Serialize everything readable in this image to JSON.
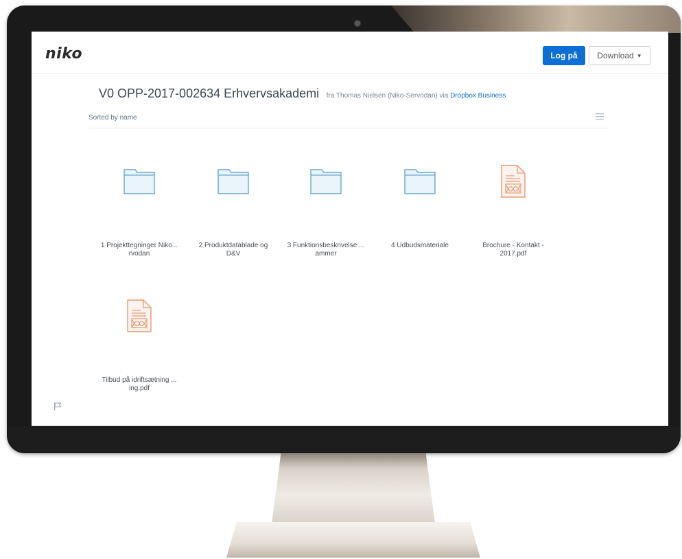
{
  "header": {
    "logo_text": "niko",
    "login_label": "Log på",
    "download_label": "Download",
    "accent_color": "#0d6fd6"
  },
  "folder": {
    "title": "V0 OPP-2017-002634 Erhvervsakademi",
    "owner_prefix": "fra Thomas Nielsen (Niko-Servodan) via",
    "owner_link": "Dropbox Business"
  },
  "sort": {
    "label": "Sorted by name",
    "view_icon": "list-view-icon"
  },
  "items": [
    {
      "type": "folder",
      "icon": "folder-icon",
      "name_line1": "1 Projekttegninger Niko...",
      "name_line2": "rvodan"
    },
    {
      "type": "folder",
      "icon": "folder-icon",
      "name_line1": "2 Produktdatablade og",
      "name_line2": "D&V"
    },
    {
      "type": "folder",
      "icon": "folder-icon",
      "name_line1": "3 Funktionsbeskrivelse ...",
      "name_line2": "ammer"
    },
    {
      "type": "folder",
      "icon": "folder-icon",
      "name_line1": "4 Udbudsmateriale",
      "name_line2": ""
    },
    {
      "type": "pdf",
      "icon": "pdf-file-icon",
      "name_line1": "Brochure - Kontakt -",
      "name_line2": "2017.pdf"
    },
    {
      "type": "pdf",
      "icon": "pdf-file-icon",
      "name_line1": "Tilbud på idriftsætning ...",
      "name_line2": "ing.pdf"
    }
  ],
  "footer": {
    "flag_icon": "flag-icon"
  }
}
